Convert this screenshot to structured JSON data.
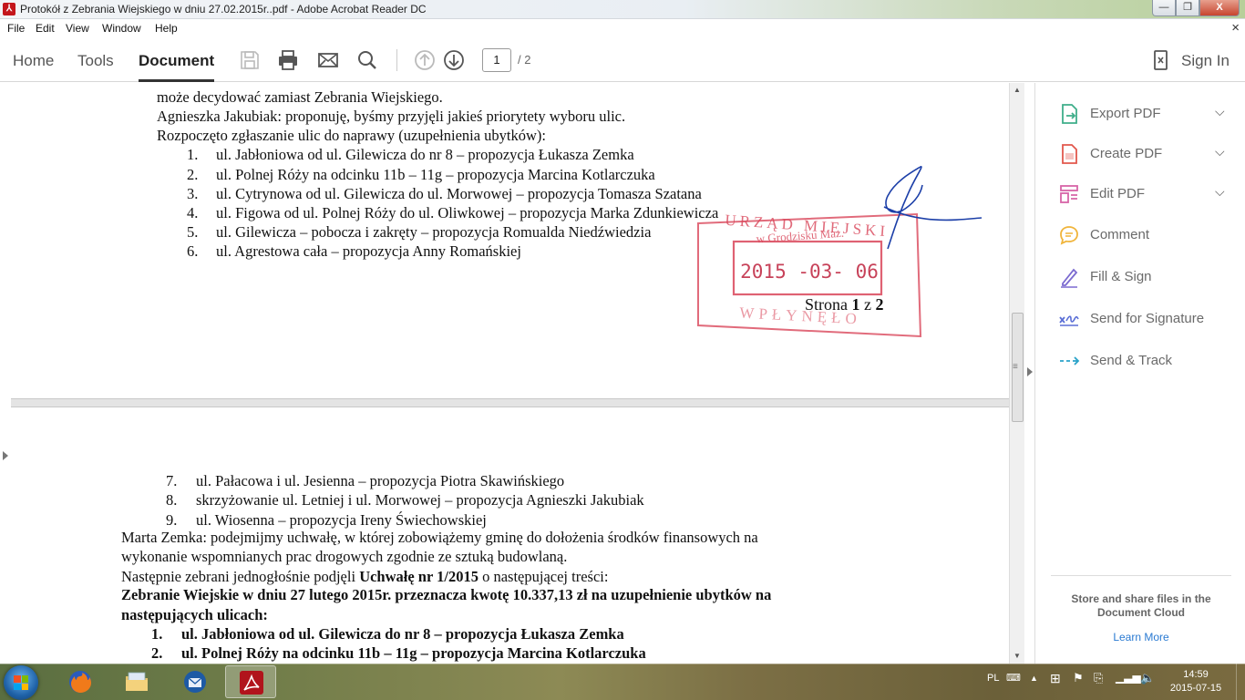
{
  "window": {
    "title": "Protokół z Zebrania Wiejskiego w dniu 27.02.2015r..pdf - Adobe Acrobat Reader DC",
    "app_icon": "acrobat-icon",
    "minimize_label": "—",
    "maximize_label": "❐",
    "close_label": "X"
  },
  "menu": {
    "items": [
      "File",
      "Edit",
      "View",
      "Window",
      "Help"
    ],
    "close_doc_label": "×"
  },
  "toolbar": {
    "tabs": [
      "Home",
      "Tools",
      "Document"
    ],
    "active_tab": "Document",
    "icons": [
      "save-icon",
      "print-icon",
      "email-icon",
      "search-icon",
      "prev-page-icon",
      "next-page-icon"
    ],
    "page_current": "1",
    "page_total": "/ 2",
    "sign_in": "Sign In"
  },
  "document": {
    "page1": {
      "lines": [
        "może decydować zamiast Zebrania Wiejskiego.",
        "Agnieszka Jakubiak: proponuję, byśmy przyjęli jakieś priorytety wyboru ulic.",
        "Rozpoczęto zgłaszanie ulic do naprawy (uzupełnienia ubytków):"
      ],
      "list": [
        {
          "num": "1.",
          "text": "ul. Jabłoniowa od ul. Gilewicza do nr 8 – propozycja Łukasza Zemka"
        },
        {
          "num": "2.",
          "text": "ul. Polnej Róży na odcinku 11b – 11g – propozycja Marcina Kotlarczuka"
        },
        {
          "num": "3.",
          "text": "ul. Cytrynowa od ul. Gilewicza do ul. Morwowej – propozycja Tomasza Szatana"
        },
        {
          "num": "4.",
          "text": "ul. Figowa od ul. Polnej Róży do ul. Oliwkowej – propozycja Marka Zdunkiewicza"
        },
        {
          "num": "5.",
          "text": "ul. Gilewicza – pobocza i zakręty – propozycja Romualda Niedźwiedzia"
        },
        {
          "num": "6.",
          "text": "ul. Agrestowa cała – propozycja Anny Romańskiej"
        }
      ],
      "page_footer_prefix": "Strona ",
      "page_footer_num": "1",
      "page_footer_mid": " z ",
      "page_footer_total": "2",
      "stamp": {
        "line1": "URZĄD MIEJSKI",
        "line2": "w Grodzisku Maz.",
        "date": "2015 -03- 06",
        "bottom": "WPŁYNĘŁO",
        "color": "#d9465a"
      },
      "signature_color": "#1c3fa8"
    },
    "page2": {
      "list": [
        {
          "num": "7.",
          "text": "ul. Pałacowa i ul. Jesienna – propozycja Piotra Skawińskiego"
        },
        {
          "num": "8.",
          "text": "skrzyżowanie ul. Letniej i ul. Morwowej – propozycja Agnieszki Jakubiak"
        },
        {
          "num": "9.",
          "text": "ul. Wiosenna – propozycja Ireny Świechowskiej"
        }
      ],
      "para1_line1": "Marta Zemka: podejmijmy uchwałę, w której zobowiążemy gminę do dołożenia środków finansowych na",
      "para1_line2": "wykonanie wspomnianych prac drogowych zgodnie ze sztuką budowlaną.",
      "para2_prefix": "Następnie zebrani jednogłośnie podjęli ",
      "para2_bold": "Uchwałę nr 1/2015",
      "para2_suffix": " o następującej treści:",
      "resolution_line1": "Zebranie Wiejskie w dniu 27 lutego 2015r. przeznacza kwotę 10.337,13 zł na uzupełnienie ubytków na",
      "resolution_line2": "następujących ulicach:",
      "bold_list": [
        {
          "num": "1.",
          "text": "ul. Jabłoniowa od ul. Gilewicza do nr 8 – propozycja Łukasza Zemka"
        },
        {
          "num": "2.",
          "text": "ul. Polnej Róży na odcinku 11b – 11g – propozycja Marcina Kotlarczuka"
        }
      ]
    }
  },
  "right_pane": {
    "tools": [
      {
        "label": "Export PDF",
        "icon": "export-pdf-icon",
        "color": "#3fae8a",
        "has_chevron": true
      },
      {
        "label": "Create PDF",
        "icon": "create-pdf-icon",
        "color": "#e2574c",
        "has_chevron": true
      },
      {
        "label": "Edit PDF",
        "icon": "edit-pdf-icon",
        "color": "#d764a8",
        "has_chevron": true
      },
      {
        "label": "Comment",
        "icon": "comment-icon",
        "color": "#f0b43a",
        "has_chevron": false
      },
      {
        "label": "Fill & Sign",
        "icon": "fill-sign-icon",
        "color": "#7b6ad0",
        "has_chevron": false
      },
      {
        "label": "Send for Signature",
        "icon": "send-signature-icon",
        "color": "#5b6fd6",
        "has_chevron": false
      },
      {
        "label": "Send & Track",
        "icon": "send-track-icon",
        "color": "#2ba3c9",
        "has_chevron": false
      }
    ],
    "cloud_text": "Store and share files in the Document Cloud",
    "cloud_link": "Learn More"
  },
  "taskbar": {
    "apps": [
      "firefox-icon",
      "file-explorer-icon",
      "thunderbird-icon",
      "acrobat-icon"
    ],
    "active_app": "acrobat-icon",
    "language": "PL",
    "time": "14:59",
    "date": "2015-07-15"
  }
}
